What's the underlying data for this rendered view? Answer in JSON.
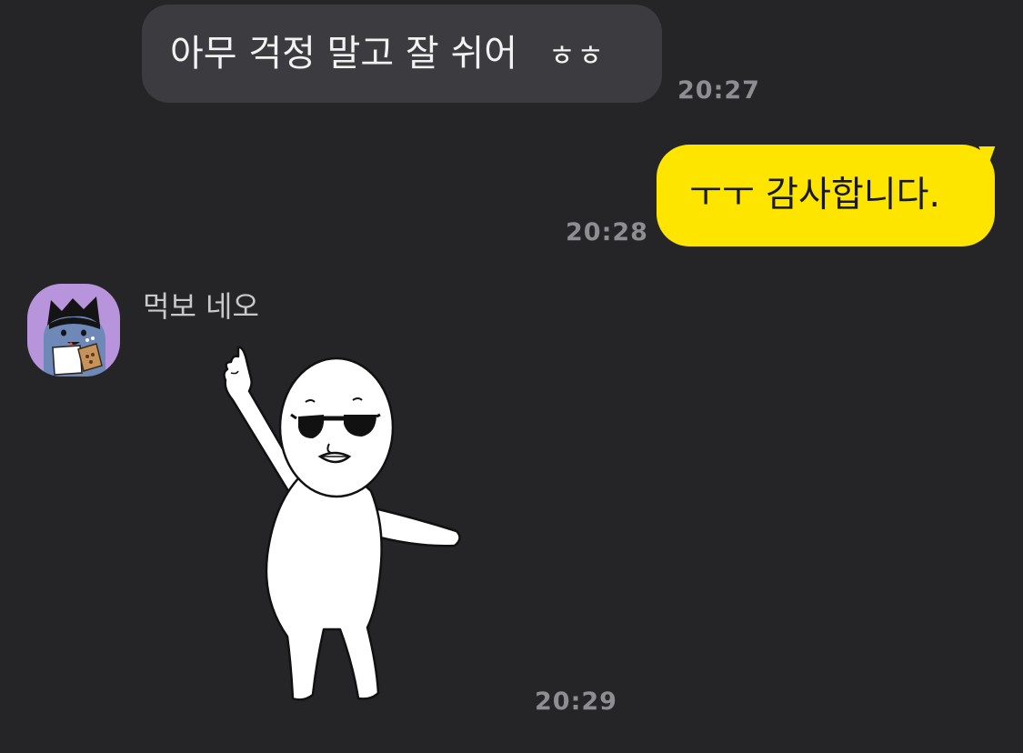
{
  "messages": [
    {
      "direction": "incoming",
      "text": "아무 걱정 말고 잘 쉬어",
      "suffix": "ㅎㅎ",
      "time": "20:27"
    },
    {
      "direction": "outgoing",
      "text": "ㅜㅜ 감사합니다.",
      "time": "20:28"
    },
    {
      "direction": "incoming",
      "sender": "먹보 네오",
      "type": "sticker",
      "sticker_icon": "sunglasses-pointing-up-sticker-icon",
      "avatar_icon": "neo-cat-eating-avatar-icon",
      "time": "20:29"
    }
  ],
  "colors": {
    "background": "#252528",
    "incoming_bubble": "#3c3c40",
    "outgoing_bubble": "#fee500",
    "timestamp": "#8d8d92",
    "avatar_bg": "#b894dd"
  }
}
